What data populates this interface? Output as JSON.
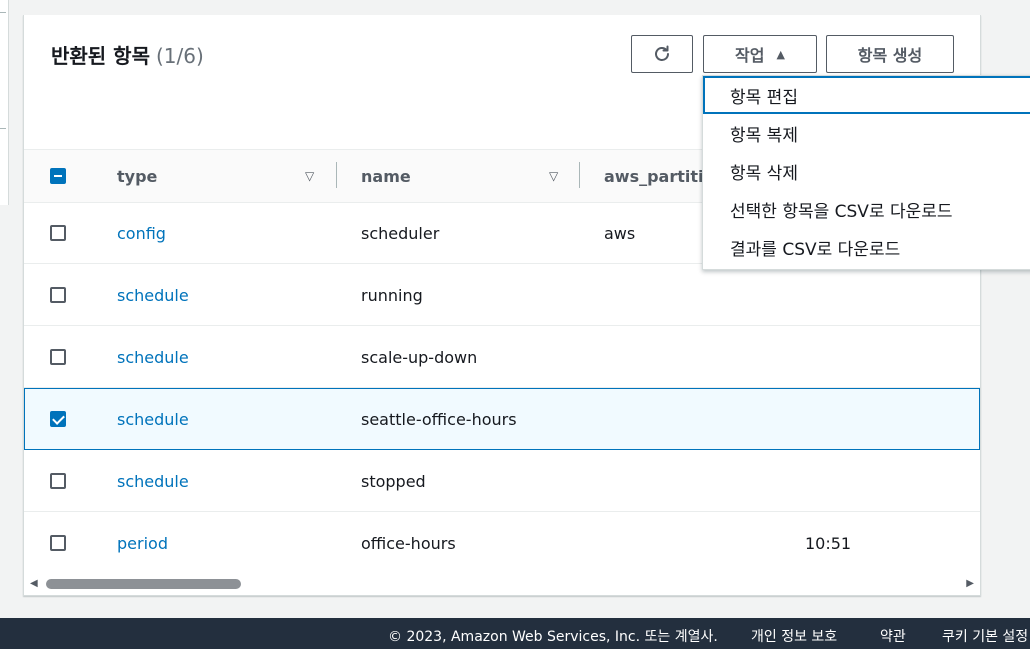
{
  "panel": {
    "title": "반환된 항목",
    "count": "(1/6)",
    "actions_label": "작업",
    "actions_caret": "▲",
    "create_label": "항목 생성"
  },
  "table": {
    "columns": [
      "type",
      "name",
      "aws_partitio"
    ],
    "rows": [
      {
        "type": "config",
        "name": "scheduler",
        "aws": "aws",
        "extra": "",
        "checked": false
      },
      {
        "type": "schedule",
        "name": "running",
        "aws": "",
        "extra": "",
        "checked": false
      },
      {
        "type": "schedule",
        "name": "scale-up-down",
        "aws": "",
        "extra": "",
        "checked": false
      },
      {
        "type": "schedule",
        "name": "seattle-office-hours",
        "aws": "",
        "extra": "",
        "checked": true
      },
      {
        "type": "schedule",
        "name": "stopped",
        "aws": "",
        "extra": "",
        "checked": false
      },
      {
        "type": "period",
        "name": "office-hours",
        "aws": "",
        "extra": "10:51",
        "checked": false
      }
    ]
  },
  "actions_menu": {
    "items": [
      "항목 편집",
      "항목 복제",
      "항목 삭제",
      "선택한 항목을 CSV로 다운로드",
      "결과를 CSV로 다운로드"
    ]
  },
  "footer": {
    "copyright": "© 2023, Amazon Web Services, Inc. 또는 계열사.",
    "privacy": "개인 정보 보호",
    "terms": "약관",
    "cookies": "쿠키 기본 설정"
  },
  "colors": {
    "link": "#0073bb",
    "footer_bg": "#232f3e",
    "selected_row_bg": "#f1faff"
  }
}
